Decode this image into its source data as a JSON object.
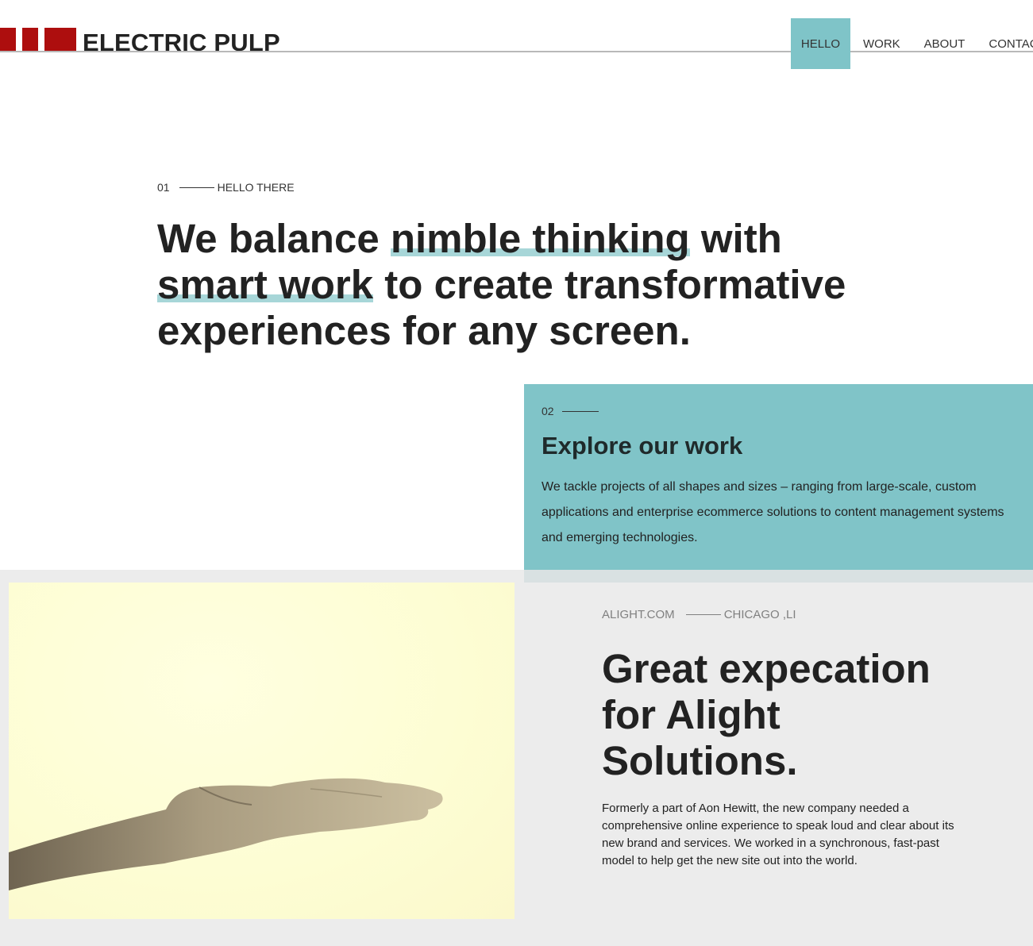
{
  "header": {
    "logo_text": "ELECTRIC PULP",
    "nav": {
      "hello": "HELLO",
      "work": "WORK",
      "about": "ABOUT",
      "contact": "CONTACT"
    }
  },
  "hero": {
    "number": "01",
    "eyebrow": "HELLO THERE",
    "title": {
      "p1": "We balance ",
      "h1": "nimble thinking",
      "p2": " with ",
      "h2": "smart work",
      "p3": " to create transformative experiences for any screen."
    }
  },
  "explore": {
    "number": "02",
    "title": "Explore our work",
    "body": "We tackle projects of all shapes and sizes – ranging from large-scale, custom applications and enterprise ecommerce solutions to content management systems and emerging technologies."
  },
  "case_study": {
    "client": "ALIGHT.COM",
    "location": "CHICAGO ,LI",
    "title": "Great expecation for Alight Solutions.",
    "body": "Formerly a part of Aon Hewitt, the new company needed a comprehensive online experience to speak loud and clear about its new brand and services. We worked in a synchronous, fast-past model to help get the new site out into the world."
  },
  "colors": {
    "brand_red": "#ad0e0e",
    "accent_teal": "#80c4c8",
    "highlight_teal": "#a7d6d8",
    "section_gray": "#ececec"
  }
}
